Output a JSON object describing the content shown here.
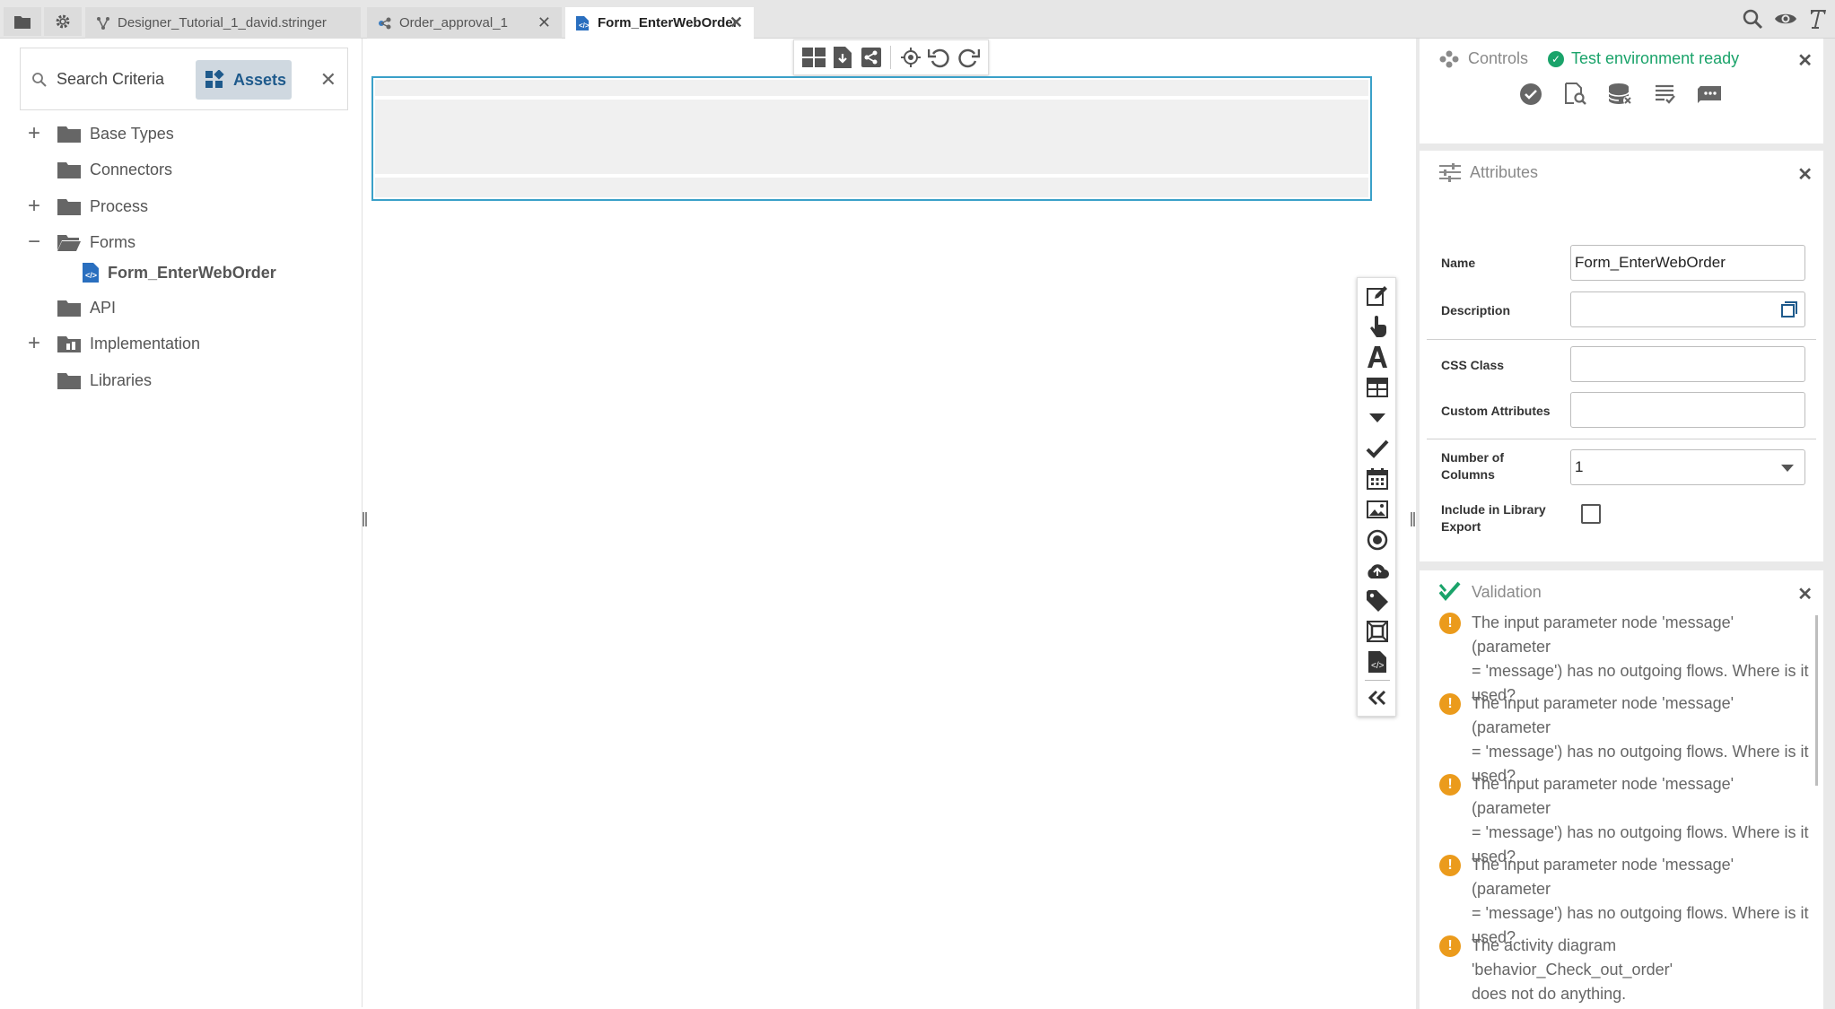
{
  "tabs": [
    {
      "label": "Designer_Tutorial_1_david.stringer",
      "active": false,
      "icon": "process-icon"
    },
    {
      "label": "Order_approval_1",
      "active": false,
      "icon": "workflow-icon"
    },
    {
      "label": "Form_EnterWebOrder",
      "active": true,
      "icon": "form-file-icon"
    }
  ],
  "left_panel": {
    "search_label": "Search Criteria",
    "assets_label": "Assets",
    "tree": [
      {
        "label": "Base Types",
        "expander": "+"
      },
      {
        "label": "Connectors",
        "expander": ""
      },
      {
        "label": "Process",
        "expander": "+"
      },
      {
        "label": "Forms",
        "expander": "−"
      },
      {
        "label": "Form_EnterWebOrder",
        "expander": "",
        "child": true
      },
      {
        "label": "API",
        "expander": ""
      },
      {
        "label": "Implementation",
        "expander": "+"
      },
      {
        "label": "Libraries",
        "expander": ""
      }
    ]
  },
  "controls": {
    "title": "Controls",
    "status": "Test environment ready"
  },
  "attributes": {
    "title": "Attributes",
    "name_label": "Name",
    "name_value": "Form_EnterWebOrder",
    "description_label": "Description",
    "description_value": "",
    "css_label": "CSS Class",
    "css_value": "",
    "custom_label": "Custom Attributes",
    "custom_value": "",
    "columns_label_1": "Number of",
    "columns_label_2": "Columns",
    "columns_value": "1",
    "include_label_1": "Include in Library",
    "include_label_2": "Export",
    "include_checked": false
  },
  "validation": {
    "title": "Validation",
    "items": [
      {
        "line1": "The input parameter node 'message' (parameter",
        "line2": "= 'message') has no outgoing flows. Where is it",
        "line3": "used?"
      },
      {
        "line1": "The input parameter node 'message' (parameter",
        "line2": "= 'message') has no outgoing flows. Where is it",
        "line3": "used?"
      },
      {
        "line1": "The input parameter node 'message' (parameter",
        "line2": "= 'message') has no outgoing flows. Where is it",
        "line3": "used?"
      },
      {
        "line1": "The input parameter node 'message' (parameter",
        "line2": "= 'message') has no outgoing flows. Where is it",
        "line3": "used?"
      },
      {
        "line1": "The activity diagram 'behavior_Check_out_order'",
        "line2": "does not do anything.",
        "line3": ""
      }
    ]
  },
  "colors": {
    "accent": "#1e5a8c",
    "status_green": "#1aa36a",
    "warning": "#eb9b1c",
    "selection": "#3aa0c8"
  }
}
